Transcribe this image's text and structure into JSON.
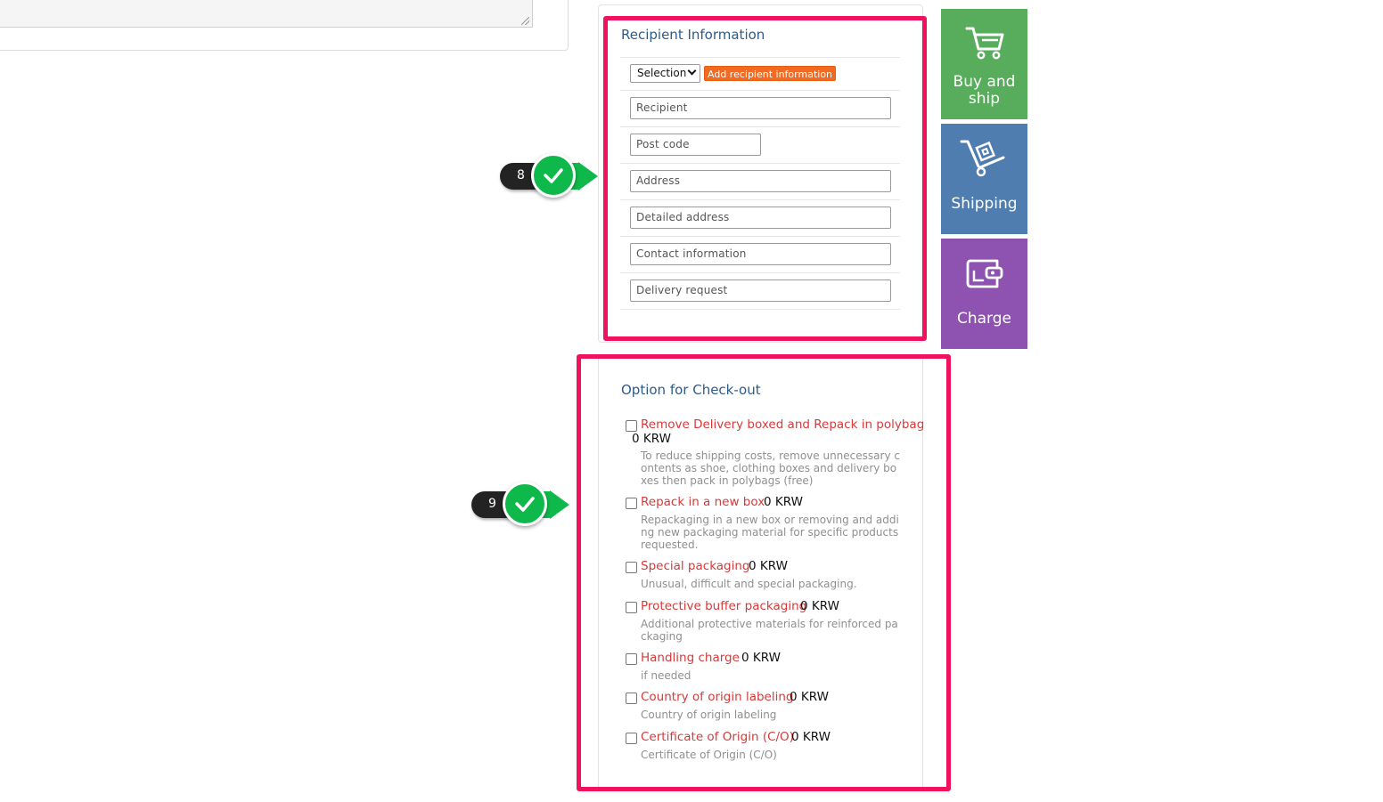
{
  "recipient": {
    "title": "Recipient Information",
    "select_value": "Selection",
    "add_button": "Add recipient information",
    "fields": {
      "recipient": "Recipient",
      "post_code": "Post code",
      "address": "Address",
      "detailed_address": "Detailed address",
      "contact": "Contact information",
      "delivery_request": "Delivery request"
    }
  },
  "badges": {
    "step8": "8",
    "step9": "9"
  },
  "tiles": {
    "buy_ship": {
      "line1": "Buy and",
      "line2": "ship",
      "icon": "cart-icon"
    },
    "shipping": {
      "label": "Shipping",
      "icon": "hand-truck-icon"
    },
    "charge": {
      "label": "Charge",
      "icon": "wallet-icon"
    }
  },
  "options": {
    "title": "Option for Check-out",
    "items": [
      {
        "title": "Remove Delivery boxed and Repack in polybag",
        "price": "0 KRW",
        "desc": "To reduce shipping costs, remove unnecessary contents as shoe, clothing boxes and delivery boxes then pack in polybags (free)"
      },
      {
        "title": "Repack in a new box",
        "price": "0 KRW",
        "desc": "Repackaging in a new box or removing and adding new packaging material for specific products requested."
      },
      {
        "title": "Special packaging",
        "price": "0 KRW",
        "desc": "Unusual, difficult and special packaging."
      },
      {
        "title": "Protective buffer packaging",
        "price": "0 KRW",
        "desc": "Additional protective materials for reinforced packaging"
      },
      {
        "title": "Handling charge",
        "price": "0 KRW",
        "desc": "if needed"
      },
      {
        "title": "Country of origin labeling",
        "price": "0 KRW",
        "desc": "Country of origin labeling"
      },
      {
        "title": "Certificate of Origin (C/O)",
        "price": "0 KRW",
        "desc": "Certificate of Origin (C/O)"
      }
    ]
  },
  "colors": {
    "highlight": "#f0115f",
    "badge_green": "#0fb84a",
    "tile_green": "#57ad5b",
    "tile_blue": "#4f7db0",
    "tile_purple": "#8e52b1",
    "option_title": "#d63a3a",
    "section_title": "#2f5b88",
    "add_button": "#f26a21"
  }
}
